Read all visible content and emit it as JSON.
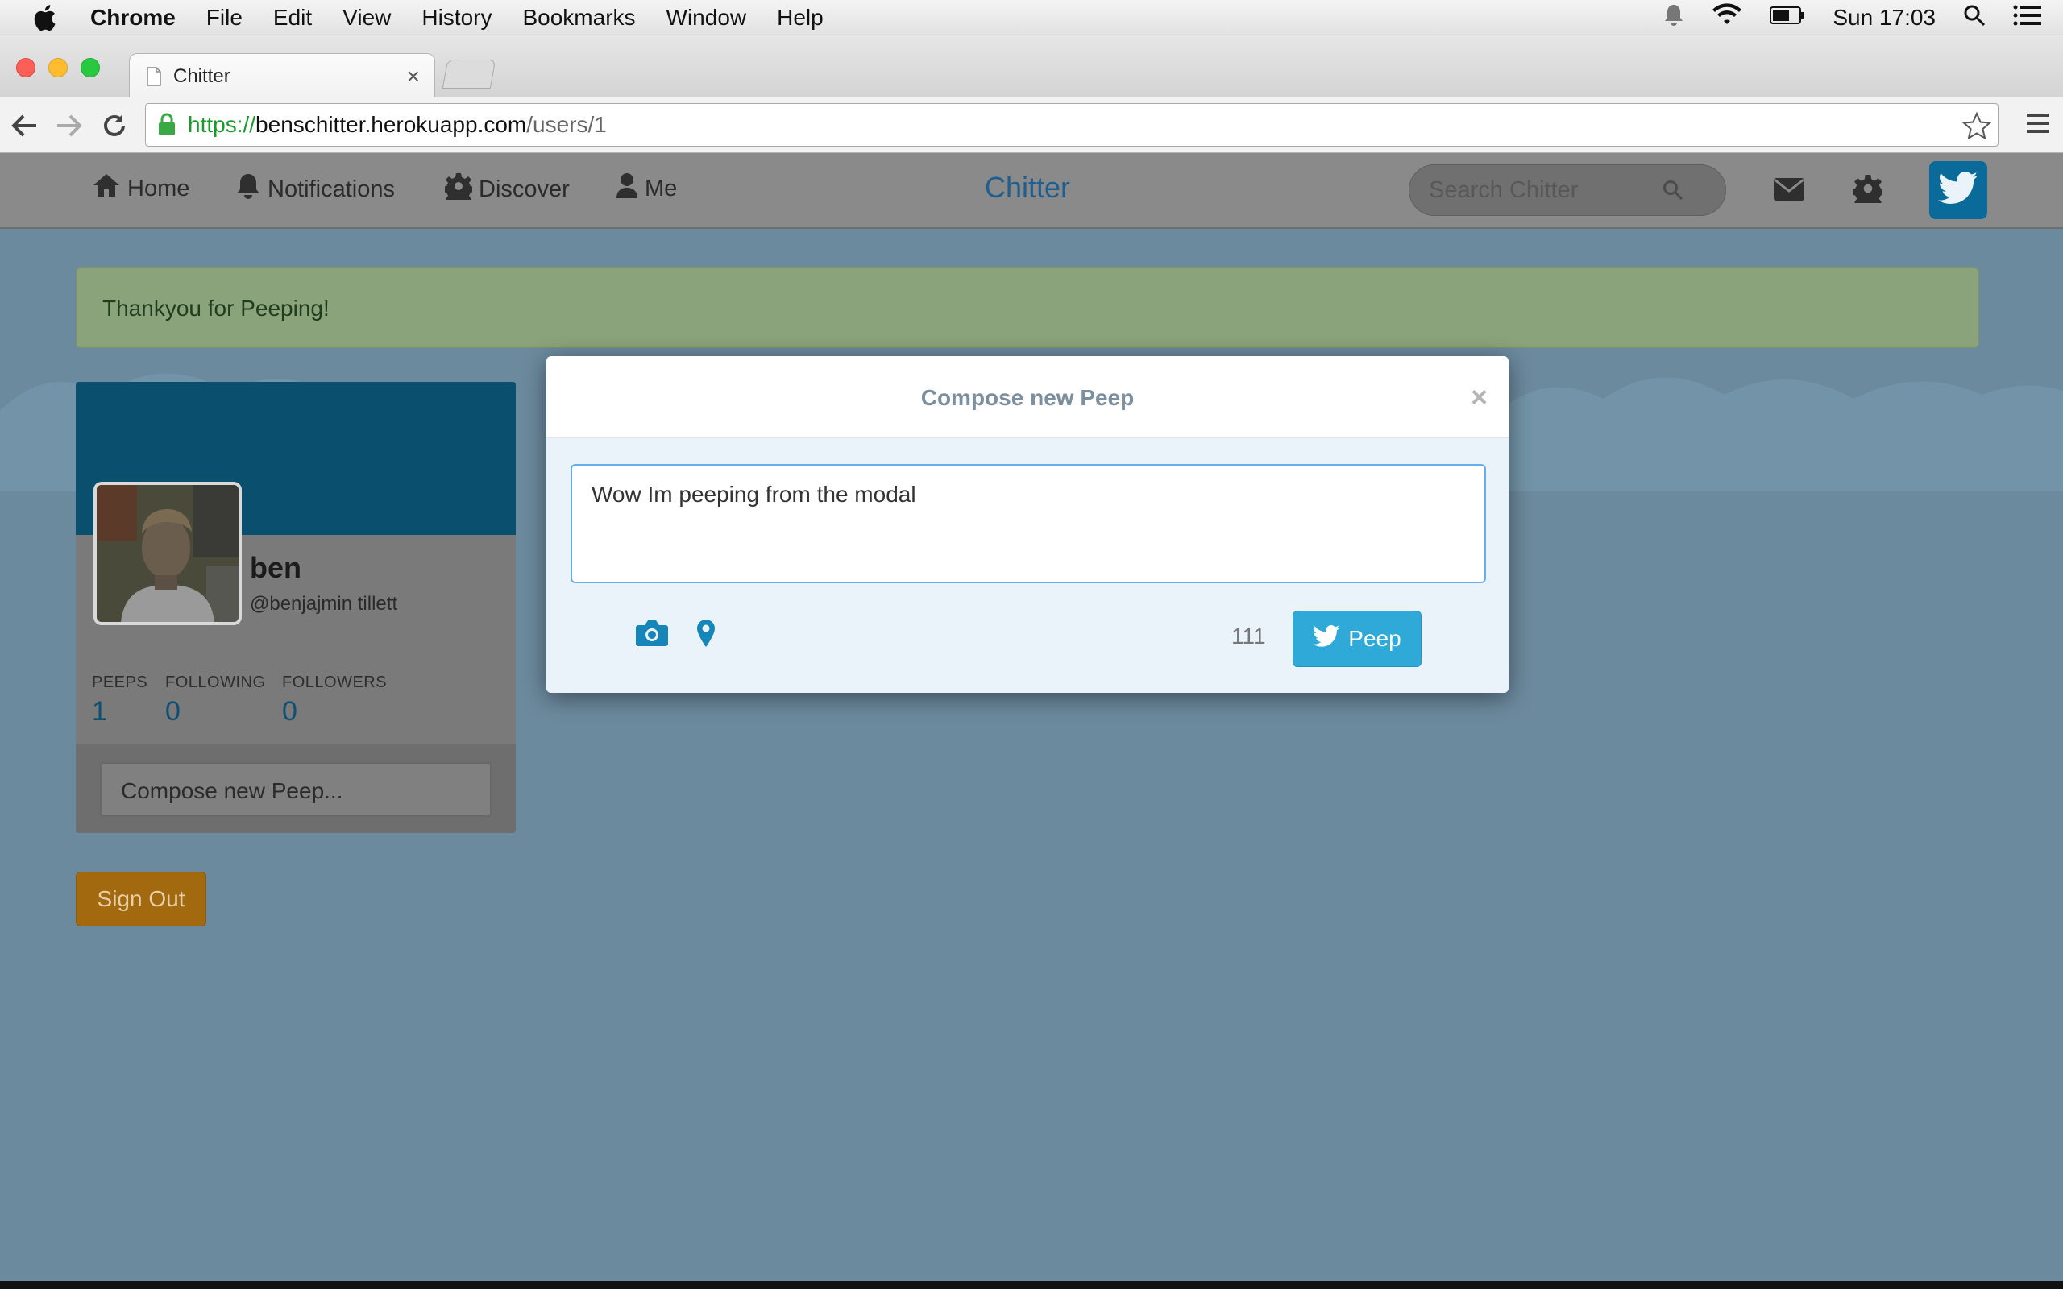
{
  "menubar": {
    "app_name": "Chrome",
    "items": [
      "File",
      "Edit",
      "View",
      "History",
      "Bookmarks",
      "Window",
      "Help"
    ],
    "clock": "Sun 17:03"
  },
  "browser": {
    "tab_title": "Chitter",
    "url": {
      "scheme": "https://",
      "host": "benschitter.herokuapp.com",
      "path": "/users/1"
    }
  },
  "navbar": {
    "items": [
      {
        "label": "Home",
        "icon": "home-icon"
      },
      {
        "label": "Notifications",
        "icon": "bell-icon"
      },
      {
        "label": "Discover",
        "icon": "gear-icon"
      },
      {
        "label": "Me",
        "icon": "person-icon"
      }
    ],
    "brand": "Chitter",
    "search_placeholder": "Search Chitter"
  },
  "alert": {
    "message": "Thankyou for Peeping!"
  },
  "profile": {
    "name": "ben",
    "handle": "@benjajmin tillett",
    "stats": [
      {
        "label": "PEEPS",
        "value": "1"
      },
      {
        "label": "FOLLOWING",
        "value": "0"
      },
      {
        "label": "FOLLOWERS",
        "value": "0"
      }
    ],
    "compose_placeholder": "Compose new Peep..."
  },
  "signout_label": "Sign Out",
  "modal": {
    "title": "Compose new Peep",
    "close_symbol": "×",
    "text": "Wow Im peeping from the modal",
    "char_count": "111",
    "submit_label": "Peep"
  },
  "colors": {
    "accent": "#2fa9d8",
    "brand": "#1f5f90",
    "signout": "#f0a020",
    "alert_bg": "#dff0d8"
  }
}
